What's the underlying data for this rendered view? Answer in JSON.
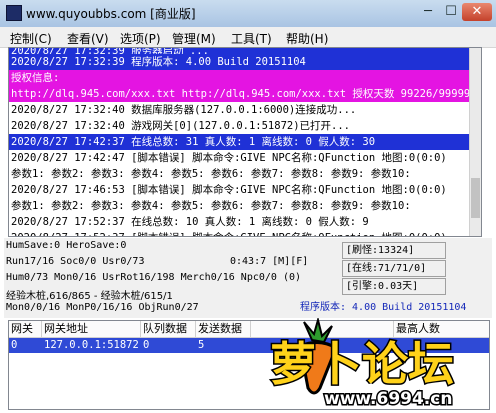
{
  "window": {
    "title": "www.quyoubbs.com [商业版]",
    "buttons": {
      "minimize": "─",
      "maximize": "☐",
      "close": "✕"
    }
  },
  "menu": [
    "控制(C)",
    "查看(V)",
    "选项(P)",
    "管理(M)",
    "工具(T)",
    "帮助(H)"
  ],
  "log": [
    {
      "text": "2020/8/27 17:32:39 服务器启动 ...",
      "style": "sel-blue"
    },
    {
      "text": "2020/8/27 17:32:39 程序版本: 4.00 Build 20151104",
      "style": "sel-blue"
    },
    {
      "text": "授权信息:",
      "style": "sel-mag"
    },
    {
      "text": "http://dlq.945.com/xxx.txt http://dlq.945.com/xxx.txt 授权天数 99226/99999",
      "style": "sel-mag"
    },
    {
      "text": "2020/8/27 17:32:40 数据库服务器(127.0.0.1:6000)连接成功...",
      "style": ""
    },
    {
      "text": "2020/8/27 17:32:40 游戏网关[0](127.0.0.1:51872)已打开...",
      "style": ""
    },
    {
      "text": "2020/8/27 17:42:37 在线总数: 31 真人数: 1 离线数: 0 假人数: 30",
      "style": "sel-blue"
    },
    {
      "text": "2020/8/27 17:42:47 [脚本错误] 脚本命令:GIVE NPC名称:QFunction 地图:0(0:0)",
      "style": ""
    },
    {
      "text": "参数1: 参数2: 参数3: 参数4: 参数5: 参数6: 参数7: 参数8: 参数9: 参数10:",
      "style": ""
    },
    {
      "text": "2020/8/27 17:46:53 [脚本错误] 脚本命令:GIVE NPC名称:QFunction 地图:0(0:0)",
      "style": ""
    },
    {
      "text": "参数1: 参数2: 参数3: 参数4: 参数5: 参数6: 参数7: 参数8: 参数9: 参数10:",
      "style": ""
    },
    {
      "text": "2020/8/27 17:52:37 在线总数: 10 真人数: 1 离线数: 0 假人数: 9",
      "style": ""
    },
    {
      "text": "2020/8/27 17:52:37 [脚本错误] 脚本命令:GIVE NPC名称:QFunction 地图:0(0:0)",
      "style": ""
    }
  ],
  "status": {
    "line1": "HumSave:0 HeroSave:0",
    "line2": "Run17/16 Soc0/0 Usr0/73",
    "time": "0:43:7 [M][F]",
    "line3": "Hum0/73 Mon0/16 UsrRot16/198 Merch0/16 Npc0/0 (0)",
    "line4": "经验木桩,616/865 - 经验木桩/615/1",
    "line5": "Mon0/0/16 MonP0/16/16 ObjRun0/27",
    "refresh": "[刷怪:13324]",
    "online": "[在线:71/71/0]",
    "engine": "[引擎:0.03天]",
    "version": "程序版本: 4.00 Build 20151104"
  },
  "grid": {
    "headers": [
      "网关",
      "网关地址",
      "队列数据",
      "发送数据",
      "",
      "最高人数"
    ],
    "rows": [
      [
        "0",
        "127.0.0.1:51872",
        "0",
        "5",
        "",
        ""
      ]
    ]
  },
  "watermark": {
    "brand": "萝卜论坛",
    "url": "www.6994.cn"
  },
  "colors": {
    "selection_blue": "#1f31d6",
    "selection_magenta": "#e414e2",
    "version_text": "#1428b8"
  }
}
